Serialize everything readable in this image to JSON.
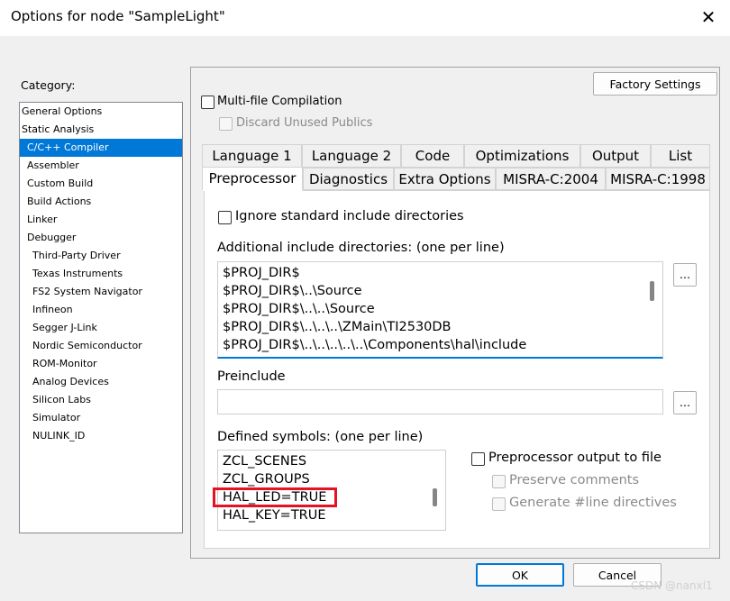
{
  "window": {
    "title": "Options for node \"SampleLight\"",
    "close_glyph": "✕"
  },
  "category": {
    "label": "Category:",
    "items": [
      {
        "label": "General Options",
        "level": 0
      },
      {
        "label": "Static Analysis",
        "level": 0
      },
      {
        "label": "C/C++ Compiler",
        "level": 1,
        "selected": true
      },
      {
        "label": "Assembler",
        "level": 1
      },
      {
        "label": "Custom Build",
        "level": 1
      },
      {
        "label": "Build Actions",
        "level": 1
      },
      {
        "label": "Linker",
        "level": 1
      },
      {
        "label": "Debugger",
        "level": 1
      },
      {
        "label": "Third-Party Driver",
        "level": 2
      },
      {
        "label": "Texas Instruments",
        "level": 2
      },
      {
        "label": "FS2 System Navigator",
        "level": 2
      },
      {
        "label": "Infineon",
        "level": 2
      },
      {
        "label": "Segger J-Link",
        "level": 2
      },
      {
        "label": "Nordic Semiconductor",
        "level": 2
      },
      {
        "label": "ROM-Monitor",
        "level": 2
      },
      {
        "label": "Analog Devices",
        "level": 2
      },
      {
        "label": "Silicon Labs",
        "level": 2
      },
      {
        "label": "Simulator",
        "level": 2
      },
      {
        "label": "NULINK_ID",
        "level": 2
      }
    ]
  },
  "factory_settings": "Factory Settings",
  "multi_file": {
    "label": "Multi-file Compilation",
    "checked": false
  },
  "discard_unused": {
    "label": "Discard Unused Publics",
    "checked": false,
    "disabled": true
  },
  "tabs_row1": [
    "Language 1",
    "Language 2",
    "Code",
    "Optimizations",
    "Output",
    "List"
  ],
  "tabs_row2": [
    "Preprocessor",
    "Diagnostics",
    "Extra Options",
    "MISRA-C:2004",
    "MISRA-C:1998"
  ],
  "active_tab": "Preprocessor",
  "preprocessor": {
    "ignore_std": {
      "label": "Ignore standard include directories",
      "checked": false
    },
    "include_dirs_label": "Additional include directories: (one per line)",
    "include_dirs": [
      "$PROJ_DIR$",
      "$PROJ_DIR$\\..\\Source",
      "$PROJ_DIR$\\..\\..\\Source",
      "$PROJ_DIR$\\..\\..\\..\\ZMain\\TI2530DB",
      "$PROJ_DIR$\\..\\..\\..\\..\\..\\Components\\hal\\include"
    ],
    "browse_label": "...",
    "preinclude_label": "Preinclude",
    "preinclude_value": "",
    "defined_label": "Defined symbols: (one per line)",
    "defined_symbols": [
      "ZCL_SCENES",
      "ZCL_GROUPS",
      "HAL_LED=TRUE",
      "HAL_KEY=TRUE"
    ],
    "highlighted_symbol": "HAL_LED=TRUE",
    "pp_output": {
      "label": "Preprocessor output to file",
      "checked": false
    },
    "preserve_comments": {
      "label": "Preserve comments",
      "checked": false,
      "disabled": true
    },
    "line_directives": {
      "label": "Generate #line directives",
      "checked": false,
      "disabled": true
    }
  },
  "buttons": {
    "ok": "OK",
    "cancel": "Cancel"
  },
  "watermark": "CSDN @nanxl1",
  "colors": {
    "selection": "#0078d7",
    "highlight_box": "#e81123"
  }
}
